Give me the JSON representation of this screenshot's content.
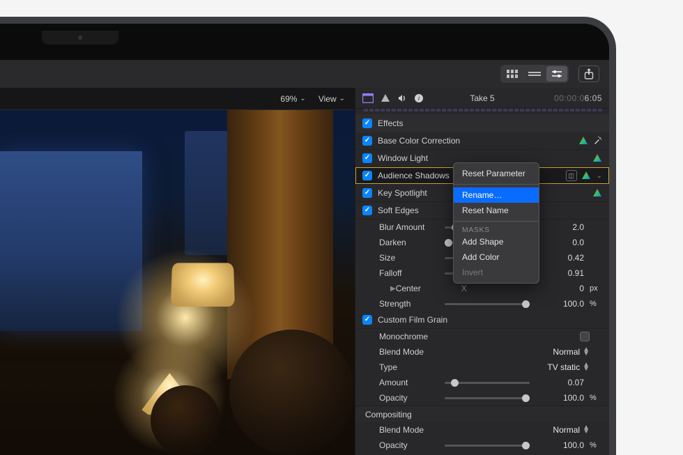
{
  "appbar": {
    "segments": [
      "grid",
      "list",
      "inspector"
    ],
    "active_segment": 2
  },
  "viewer": {
    "zoom": "69%",
    "view_menu": "View"
  },
  "clip": {
    "name": "Take 5",
    "tc_prefix": "00:00:0",
    "tc_end": "6:05"
  },
  "effects": {
    "header": "Effects",
    "items": [
      {
        "label": "Base Color Correction",
        "checked": true,
        "icons": [
          "prism",
          "wand"
        ]
      },
      {
        "label": "Window Light",
        "checked": true,
        "icons": [
          "prism"
        ]
      },
      {
        "label": "Audience Shadows",
        "checked": true,
        "selected": true,
        "icons": [
          "mask",
          "prism"
        ],
        "chev": true
      },
      {
        "label": "Key Spotlight",
        "checked": true,
        "icons": [
          "prism"
        ]
      },
      {
        "label": "Soft Edges",
        "checked": true,
        "params": [
          {
            "name": "Blur Amount",
            "value": "2.0",
            "unit": "",
            "pos": 0.08
          },
          {
            "name": "Darken",
            "value": "0.0",
            "unit": "",
            "pos": 0.0
          },
          {
            "name": "Size",
            "value": "0.42",
            "unit": "",
            "pos": 0.42
          },
          {
            "name": "Falloff",
            "value": "0.91",
            "unit": "",
            "pos": 0.91
          },
          {
            "name": "Center",
            "x_label": "X",
            "value": "0",
            "unit": "px",
            "disclose": true,
            "pos": 0.5
          },
          {
            "name": "Strength",
            "value": "100.0",
            "unit": "%",
            "pos": 1.0
          }
        ]
      },
      {
        "label": "Custom Film Grain",
        "checked": true,
        "grain": {
          "monochrome_label": "Monochrome",
          "blend_mode_label": "Blend Mode",
          "blend_mode_value": "Normal",
          "type_label": "Type",
          "type_value": "TV static",
          "amount_label": "Amount",
          "amount_value": "0.07",
          "amount_pos": 0.07,
          "opacity_label": "Opacity",
          "opacity_value": "100.0",
          "opacity_unit": "%",
          "opacity_pos": 1.0
        }
      }
    ]
  },
  "compositing": {
    "header": "Compositing",
    "blend_mode_label": "Blend Mode",
    "blend_mode_value": "Normal",
    "opacity_label": "Opacity",
    "opacity_value": "100.0",
    "opacity_unit": "%",
    "opacity_pos": 1.0
  },
  "context_menu": {
    "reset_param": "Reset Parameter",
    "rename": "Rename…",
    "reset_name": "Reset Name",
    "masks_label": "MASKS",
    "add_shape": "Add Shape",
    "add_color": "Add Color",
    "invert": "Invert"
  }
}
